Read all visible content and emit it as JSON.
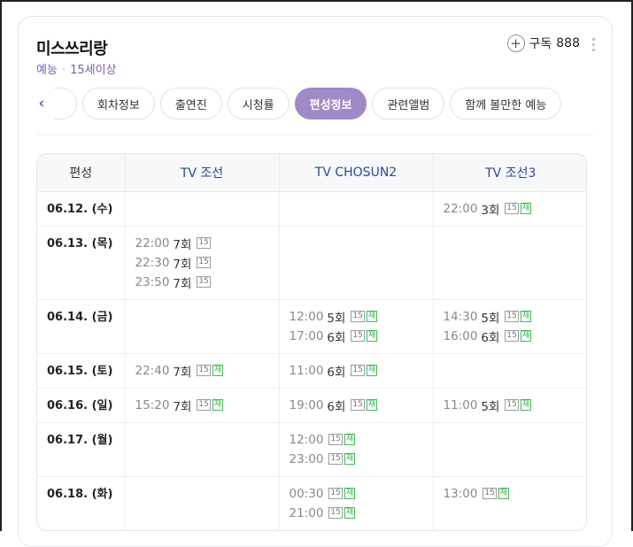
{
  "header": {
    "title": "미스쓰리랑",
    "category": "예능",
    "rating": "15세이상",
    "subscribe_label": "구독",
    "subscribe_count": "888"
  },
  "tabs": [
    {
      "label": "회차정보",
      "active": false
    },
    {
      "label": "출연진",
      "active": false
    },
    {
      "label": "시청률",
      "active": false
    },
    {
      "label": "편성정보",
      "active": true
    },
    {
      "label": "관련앨범",
      "active": false
    },
    {
      "label": "함께 볼만한 예능",
      "active": false
    }
  ],
  "schedule": {
    "columns": [
      "편성",
      "TV 조선",
      "TV CHOSUN2",
      "TV 조선3"
    ],
    "rows": [
      {
        "date": "06.12. (수)",
        "cells": [
          [],
          [],
          [
            {
              "time": "22:00",
              "ep": "3회",
              "rating": "15",
              "rerun": "재"
            }
          ]
        ]
      },
      {
        "date": "06.13. (목)",
        "cells": [
          [
            {
              "time": "22:00",
              "ep": "7회",
              "rating": "15",
              "rerun": ""
            },
            {
              "time": "22:30",
              "ep": "7회",
              "rating": "15",
              "rerun": ""
            },
            {
              "time": "23:50",
              "ep": "7회",
              "rating": "15",
              "rerun": ""
            }
          ],
          [],
          []
        ]
      },
      {
        "date": "06.14. (금)",
        "cells": [
          [],
          [
            {
              "time": "12:00",
              "ep": "5회",
              "rating": "15",
              "rerun": "재"
            },
            {
              "time": "17:00",
              "ep": "6회",
              "rating": "15",
              "rerun": "재"
            }
          ],
          [
            {
              "time": "14:30",
              "ep": "5회",
              "rating": "15",
              "rerun": "재"
            },
            {
              "time": "16:00",
              "ep": "6회",
              "rating": "15",
              "rerun": "재"
            }
          ]
        ]
      },
      {
        "date": "06.15. (토)",
        "cells": [
          [
            {
              "time": "22:40",
              "ep": "7회",
              "rating": "15",
              "rerun": "재"
            }
          ],
          [
            {
              "time": "11:00",
              "ep": "6회",
              "rating": "15",
              "rerun": "재"
            }
          ],
          []
        ]
      },
      {
        "date": "06.16. (일)",
        "cells": [
          [
            {
              "time": "15:20",
              "ep": "7회",
              "rating": "15",
              "rerun": "재"
            }
          ],
          [
            {
              "time": "19:00",
              "ep": "6회",
              "rating": "15",
              "rerun": "재"
            }
          ],
          [
            {
              "time": "11:00",
              "ep": "5회",
              "rating": "15",
              "rerun": "재"
            }
          ]
        ]
      },
      {
        "date": "06.17. (월)",
        "cells": [
          [],
          [
            {
              "time": "12:00",
              "ep": "",
              "rating": "15",
              "rerun": "재"
            },
            {
              "time": "23:00",
              "ep": "",
              "rating": "15",
              "rerun": "재"
            }
          ],
          []
        ]
      },
      {
        "date": "06.18. (화)",
        "cells": [
          [],
          [
            {
              "time": "00:30",
              "ep": "",
              "rating": "15",
              "rerun": "재"
            },
            {
              "time": "21:00",
              "ep": "",
              "rating": "15",
              "rerun": "재"
            }
          ],
          [
            {
              "time": "13:00",
              "ep": "",
              "rating": "15",
              "rerun": "재"
            }
          ]
        ]
      }
    ]
  },
  "colors": {
    "accent": "#a08ac6",
    "subtitle": "#7a5cb7",
    "channel_header": "#2b4a93",
    "rerun_badge": "#2fae4a"
  },
  "icons": {
    "subscribe": "plus-circle-icon",
    "more": "more-vertical-icon",
    "prev": "chevron-left-icon"
  }
}
